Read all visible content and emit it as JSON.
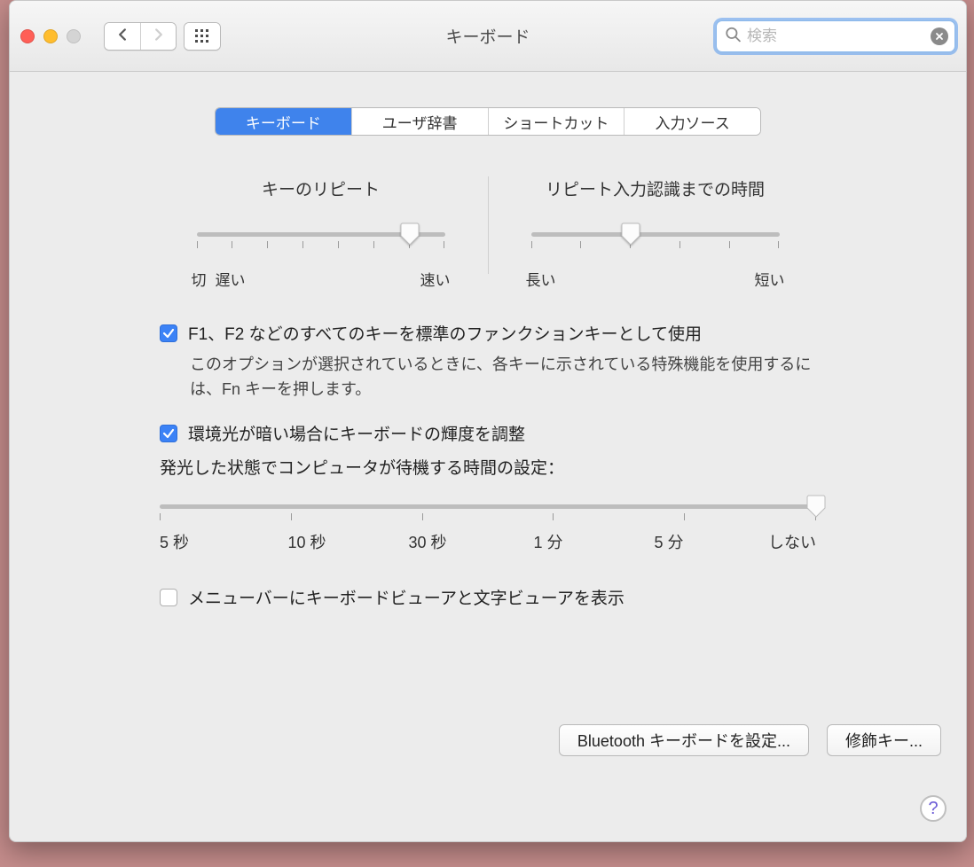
{
  "window": {
    "title": "キーボード",
    "search_placeholder": "検索",
    "search_value": ""
  },
  "tabs": {
    "keyboard": "キーボード",
    "user_dict": "ユーザ辞書",
    "shortcut": "ショートカット",
    "input_source": "入力ソース"
  },
  "sliders": {
    "key_repeat": {
      "title": "キーのリピート",
      "min_label": "切",
      "slow_label": "遅い",
      "fast_label": "速い",
      "ticks": 8,
      "value_index": 6
    },
    "delay": {
      "title": "リピート入力認識までの時間",
      "long_label": "長い",
      "short_label": "短い",
      "ticks": 6,
      "value_index": 2
    }
  },
  "options": {
    "fn_keys": {
      "checked": true,
      "label": "F1、F2 などのすべてのキーを標準のファンクションキーとして使用",
      "sub": "このオプションが選択されているときに、各キーに示されている特殊機能を使用するには、Fn キーを押します。"
    },
    "backlight": {
      "checked": true,
      "label": "環境光が暗い場合にキーボードの輝度を調整"
    },
    "backlight_wait": {
      "label": "発光した状態でコンピュータが待機する時間の設定：",
      "ticks": [
        "5 秒",
        "10 秒",
        "30 秒",
        "1 分",
        "5 分",
        "しない"
      ],
      "value_index": 5
    },
    "menubar_viewer": {
      "checked": false,
      "label": "メニューバーにキーボードビューアと文字ビューアを表示"
    }
  },
  "buttons": {
    "bluetooth": "Bluetooth キーボードを設定...",
    "modifier": "修飾キー...",
    "help": "?"
  }
}
